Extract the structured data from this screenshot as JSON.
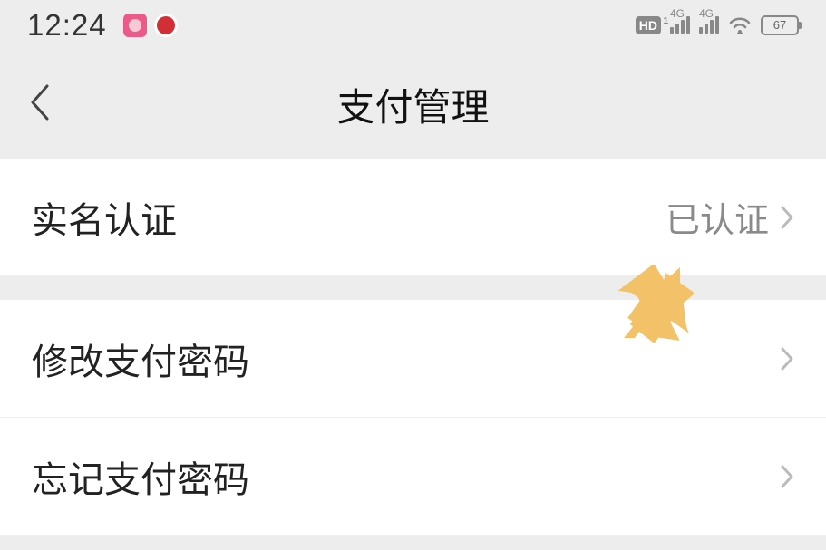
{
  "status_bar": {
    "time": "12:24",
    "hd_label": "HD",
    "signal_label": "4G",
    "battery_percent": "67"
  },
  "nav": {
    "title": "支付管理"
  },
  "items": {
    "identity": {
      "label": "实名认证",
      "value": "已认证"
    },
    "change_pwd": {
      "label": "修改支付密码"
    },
    "forgot_pwd": {
      "label": "忘记支付密码"
    }
  }
}
